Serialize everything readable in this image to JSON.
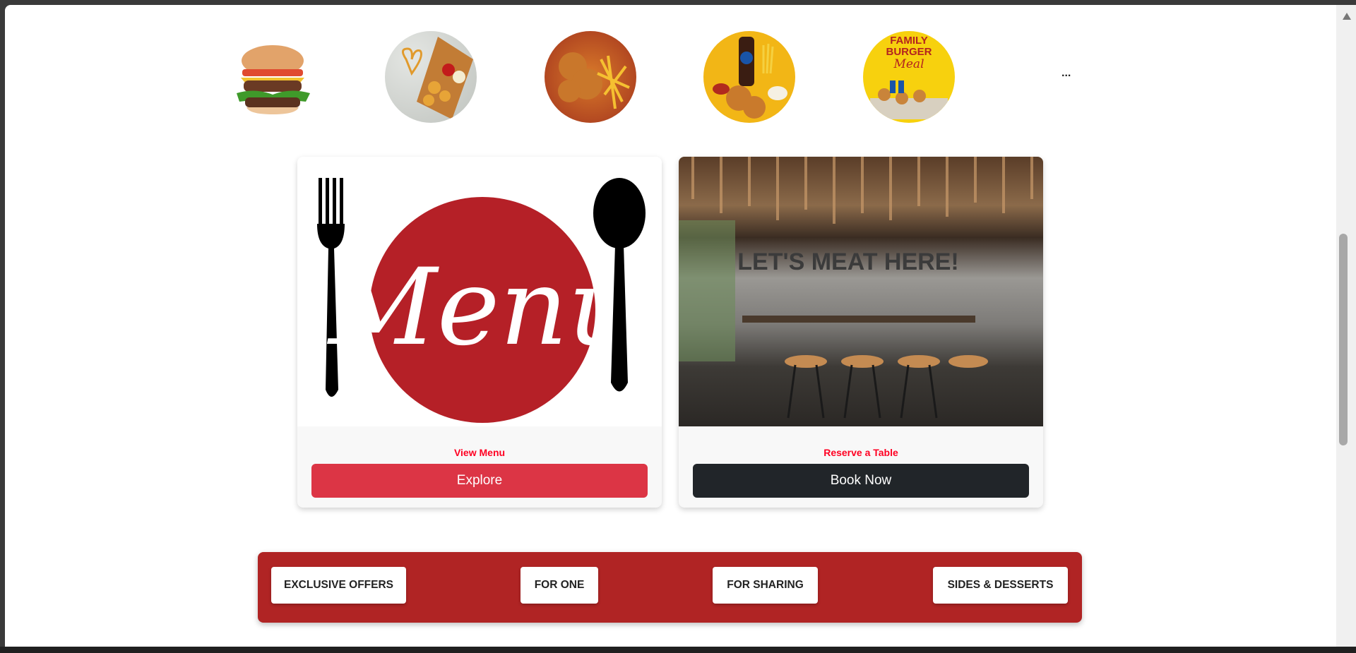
{
  "categories_strip": {
    "items": [
      {
        "name": "burger"
      },
      {
        "name": "love-chicken-fries"
      },
      {
        "name": "fried-chicken-fries"
      },
      {
        "name": "chicken-pepsi-combo"
      },
      {
        "name": "family-burger-meal",
        "logo_text": "FAMILY BURGER Meal"
      }
    ],
    "more_label": "..."
  },
  "cards": [
    {
      "logo_text": "Menu",
      "caption": "View Menu",
      "button_label": "Explore",
      "button_color": "#dc3545"
    },
    {
      "sign_text": "LET'S MEAT HERE!",
      "caption": "Reserve a Table",
      "button_label": "Book Now",
      "button_color": "#212529"
    }
  ],
  "category_bar": {
    "background": "#b02424",
    "buttons": [
      "EXCLUSIVE OFFERS",
      "FOR ONE",
      "FOR SHARING",
      "SIDES & DESSERTS"
    ]
  }
}
